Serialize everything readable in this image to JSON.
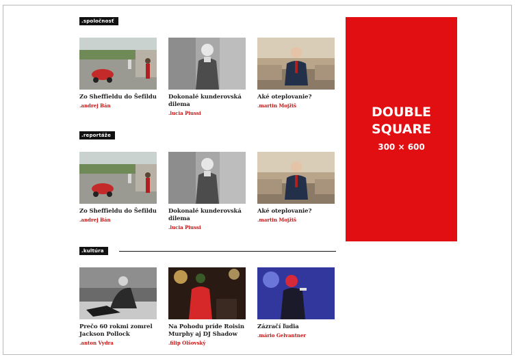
{
  "sections": [
    {
      "label": ".spoločnosť",
      "cards": [
        {
          "title": "Zo Sheffieldu do Šefildu",
          "author": ".andrej Bán",
          "image_icon": "kids-playing-photo"
        },
        {
          "title": "Dokonalé kunderovská dilema",
          "author": ".lucia Piussi",
          "image_icon": "man-bw-portrait-photo"
        },
        {
          "title": "Aké oteplovanie?",
          "author": ".martin Mojžiš",
          "image_icon": "man-on-sofa-photo"
        }
      ]
    },
    {
      "label": ".reportáže",
      "cards": [
        {
          "title": "Zo Sheffieldu do Šefildu",
          "author": ".andrej Bán",
          "image_icon": "kids-playing-photo"
        },
        {
          "title": "Dokonalé kunderovská dilema",
          "author": ".lucia Piussi",
          "image_icon": "man-bw-portrait-photo"
        },
        {
          "title": "Aké oteplovanie?",
          "author": ".martin Mojžiš",
          "image_icon": "man-on-sofa-photo"
        }
      ]
    },
    {
      "label": ".kultúra",
      "cards": [
        {
          "title": "Prečo 60 rokmi zomrel Jackson Pollock",
          "author": ".anton Vydra",
          "image_icon": "painter-bw-photo"
        },
        {
          "title": "Na Pohodu príde Roisin Murphy aj DJ Shadow",
          "author": ".filip Olšovský",
          "image_icon": "singer-red-stage-photo"
        },
        {
          "title": "Zázračí ľudia",
          "author": ".mário Gelvantner",
          "image_icon": "singer-blue-stage-photo"
        }
      ]
    }
  ],
  "ad": {
    "line1": "DOUBLE",
    "line2": "SQUARE",
    "line3": "300 × 600",
    "color": "#e10f12"
  }
}
